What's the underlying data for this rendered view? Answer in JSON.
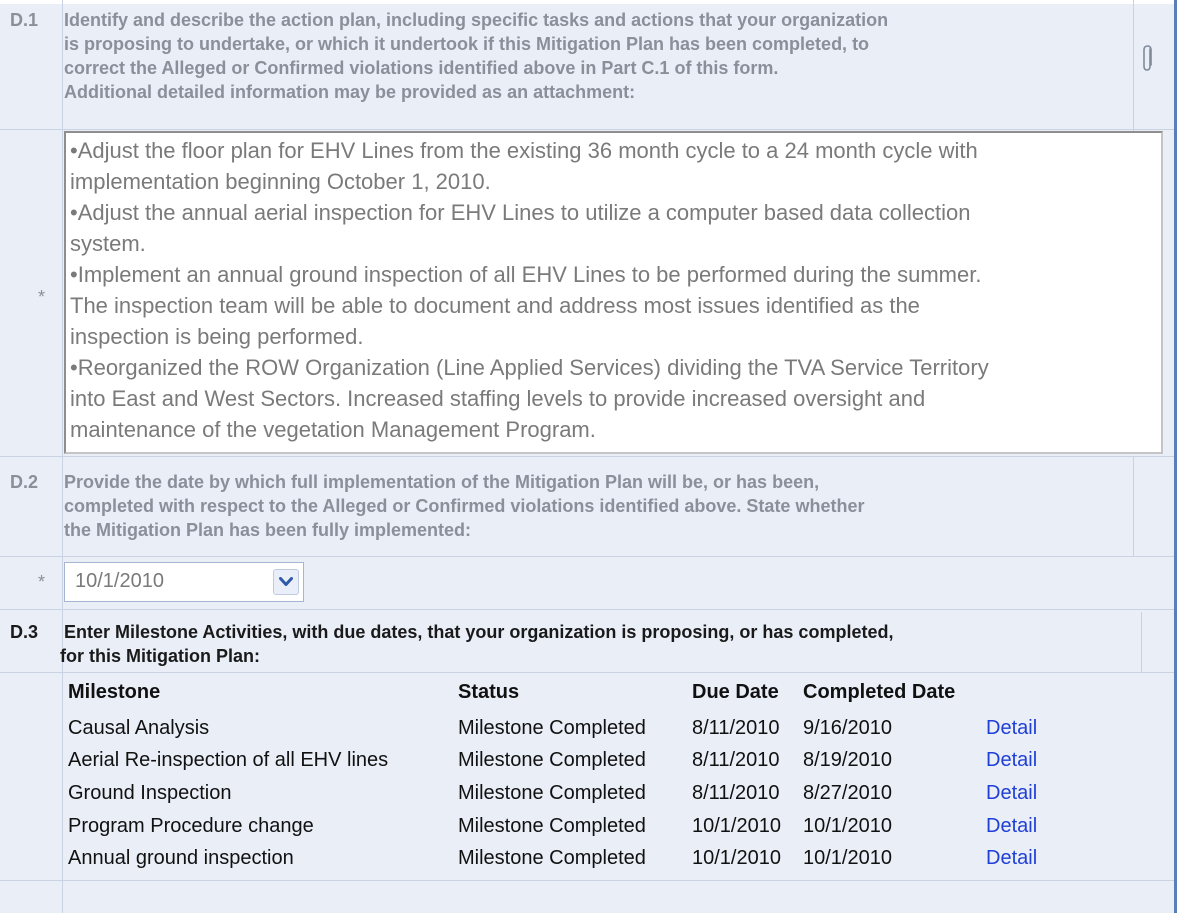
{
  "sections": {
    "d1": {
      "number": "D.1",
      "question_lines": [
        "Identify and describe the action plan, including specific tasks and actions that your organization",
        "is proposing to undertake, or which it undertook if this Mitigation Plan has been completed, to",
        "correct the Alleged or Confirmed violations identified above in Part C.1 of this form.",
        "Additional detailed information may be provided as an attachment:"
      ],
      "required_marker": "*",
      "answer_lines": [
        "•Adjust the floor plan for EHV Lines from the existing 36 month cycle to a 24 month cycle with",
        "implementation beginning October 1, 2010.",
        "•Adjust the annual aerial inspection for EHV Lines to utilize a computer based data collection",
        "system.",
        "•Implement an annual ground inspection of all EHV Lines to be performed during the summer.",
        "The inspection team will be able to document and address most issues identified as the",
        "inspection is being performed.",
        "•Reorganized the ROW Organization (Line Applied Services) dividing the TVA Service Territory",
        "into East and West Sectors.  Increased staffing levels to provide increased oversight and",
        "maintenance of the vegetation Management Program."
      ],
      "attachment_icon": "paperclip-icon"
    },
    "d2": {
      "number": "D.2",
      "question_lines": [
        "Provide the date by which full implementation of the Mitigation Plan will be, or has been,",
        "completed with respect to the Alleged or Confirmed violations identified above. State whether",
        "the Mitigation Plan has been fully implemented:"
      ],
      "required_marker": "*",
      "date_value": "10/1/2010",
      "dropdown_icon": "chevron-down-icon"
    },
    "d3": {
      "number": "D.3",
      "question_lines": [
        "Enter Milestone Activities, with due dates, that your organization is proposing, or has completed,",
        "for this Mitigation Plan:"
      ],
      "table": {
        "headers": [
          "Milestone",
          "Status",
          "Due Date",
          "Completed Date"
        ],
        "rows": [
          {
            "milestone": "Causal Analysis",
            "status": "Milestone Completed",
            "due": "8/11/2010",
            "completed": "9/16/2010",
            "link": "Detail"
          },
          {
            "milestone": "Aerial Re-inspection of all EHV lines",
            "status": "Milestone Completed",
            "due": "8/11/2010",
            "completed": "8/19/2010",
            "link": "Detail"
          },
          {
            "milestone": "Ground Inspection",
            "status": "Milestone Completed",
            "due": "8/11/2010",
            "completed": "8/27/2010",
            "link": "Detail"
          },
          {
            "milestone": "Program Procedure change",
            "status": "Milestone Completed",
            "due": "10/1/2010",
            "completed": "10/1/2010",
            "link": "Detail"
          },
          {
            "milestone": "Annual ground inspection",
            "status": "Milestone Completed",
            "due": "10/1/2010",
            "completed": "10/1/2010",
            "link": "Detail"
          }
        ]
      }
    }
  },
  "colors": {
    "panel_bg": "#e9eef7",
    "frame_border": "#5a7fb8",
    "link": "#1f3fd6",
    "muted_text": "#8a8f99"
  }
}
